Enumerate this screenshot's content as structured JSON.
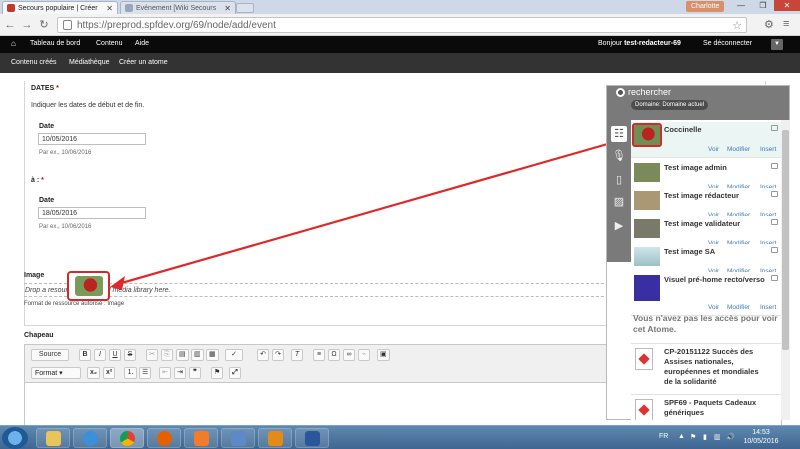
{
  "browser": {
    "tabs": [
      {
        "label": "Secours populaire | Créer",
        "active": true
      },
      {
        "label": "Evénement [Wiki Secours",
        "active": false
      }
    ],
    "user_badge": "Charlotte",
    "window_controls": {
      "minimize": "—",
      "maximize": "❐",
      "close": "✕"
    },
    "url": "https://preprod.spfdev.org/69/node/add/event"
  },
  "toolbar": {
    "items": [
      "Tableau de bord",
      "Contenu",
      "Aide"
    ],
    "greeting": "Bonjour",
    "username": "test-redacteur-69",
    "logout": "Se déconnecter"
  },
  "subtoolbar": {
    "items": [
      "Contenu créés",
      "Médiathèque",
      "Créer un atome"
    ]
  },
  "form": {
    "dates_label": "DATES",
    "dates_help": "Indiquer les dates de début et de fin.",
    "start_date_label": "Date",
    "start_date_value": "10/05/2016",
    "start_date_hint": "Par ex., 10/06/2016",
    "to_label": "à :",
    "end_date_label": "Date",
    "end_date_value": "18/05/2016",
    "end_date_hint": "Par ex., 10/06/2016",
    "required_mark": "*",
    "image_label": "Image",
    "image_drop_text": "Drop a resource from Scald media library here.",
    "image_format_text": "Format de ressource autorisé : Image",
    "chapeau_label": "Chapeau",
    "editor_source_label": "Source",
    "editor_format_label": "Format"
  },
  "media_panel": {
    "search_label": "rechercher",
    "domain_label": "Domaine: Domaine actuel",
    "action_labels": {
      "view": "Voir",
      "edit": "Modifier",
      "insert": "Insert"
    },
    "items": [
      {
        "name": "Coccinelle",
        "selected": true,
        "thumb_color": "#8a2b2b"
      },
      {
        "name": "Test image admin",
        "selected": false,
        "thumb_color": "#7a8a5a"
      },
      {
        "name": "Test image rédacteur",
        "selected": false,
        "thumb_color": "#a99873"
      },
      {
        "name": "Test image validateur",
        "selected": false,
        "thumb_color": "#7a7a6a"
      },
      {
        "name": "Test image SA",
        "selected": false,
        "thumb_color": "#9dc1c6"
      },
      {
        "name": "Visuel pré-home recto/verso",
        "selected": false,
        "thumb_color": "#3a2fa0"
      }
    ],
    "no_access_text": "Vous n'avez pas les accès pour voir cet Atome.",
    "documents": [
      {
        "name": "CP-20151122 Succès des Assises nationales, européennes et mondiales de la solidarité"
      },
      {
        "name": "SPF69 - Paquets Cadeaux génériques"
      }
    ]
  },
  "taskbar": {
    "language": "FR",
    "time": "14:53",
    "date": "10/05/2016"
  }
}
